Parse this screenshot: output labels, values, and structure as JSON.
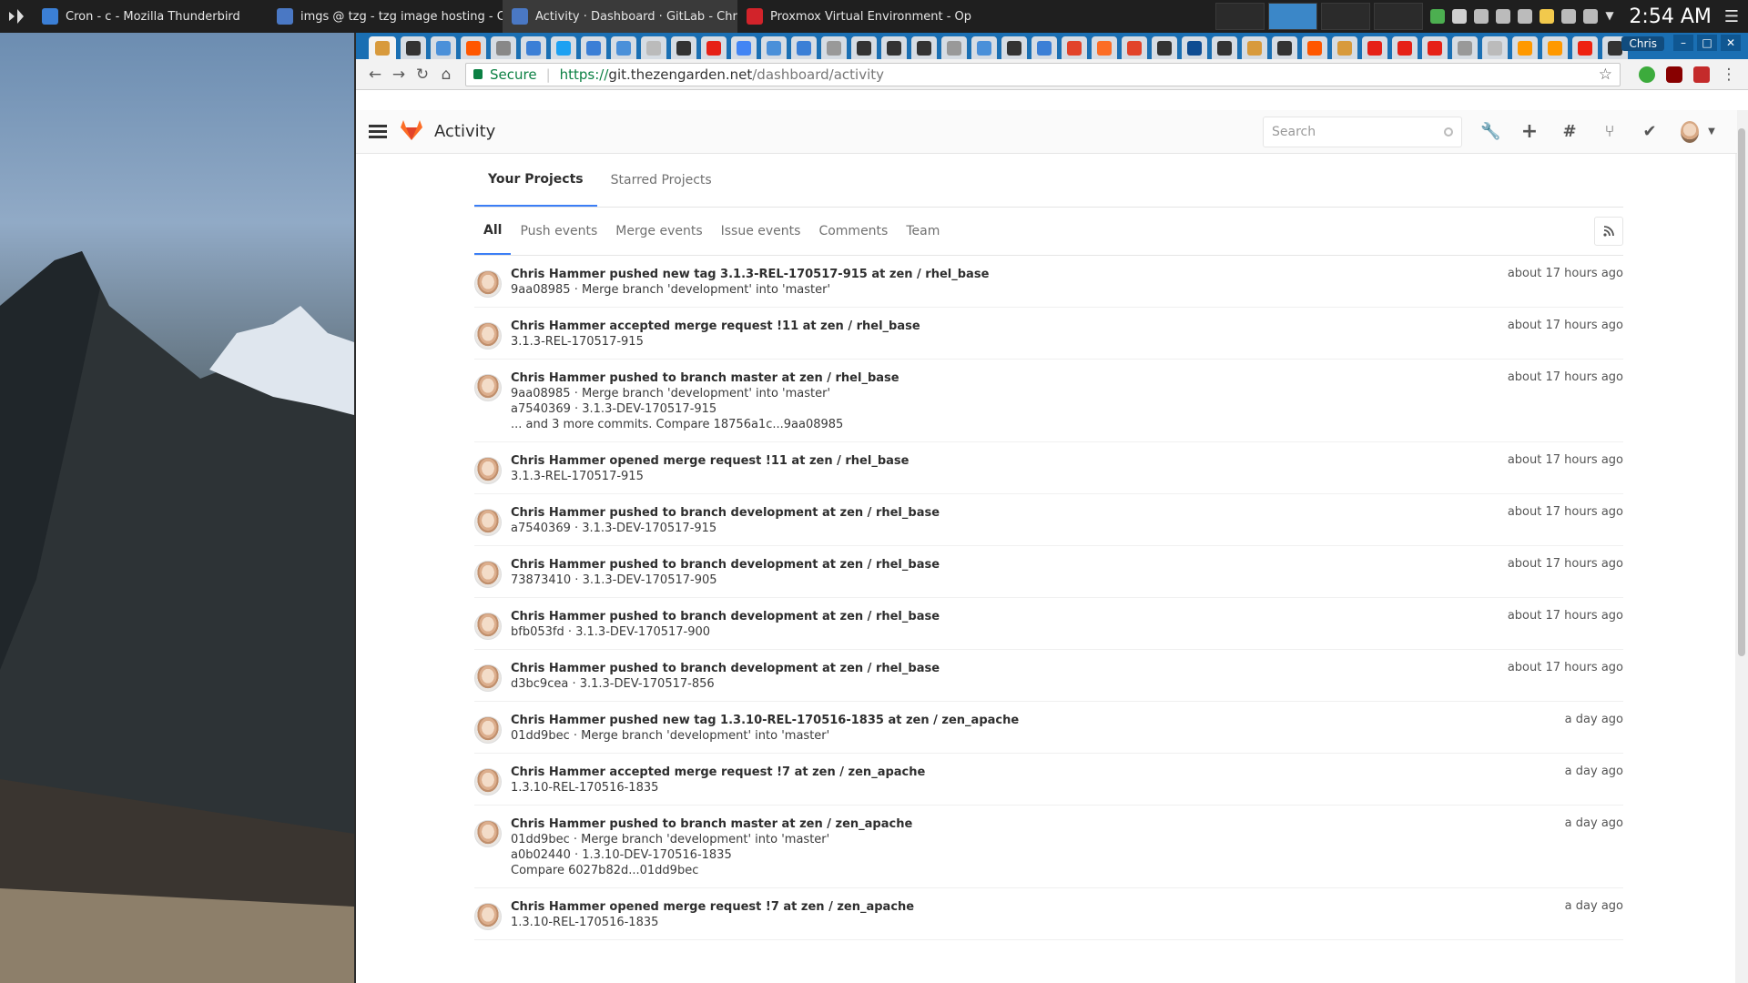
{
  "taskbar": {
    "tasks": [
      {
        "label": "Cron - c - Mozilla Thunderbird",
        "color": "#3b7fd6"
      },
      {
        "label": "imgs @ tzg - tzg image hosting - C...",
        "color": "#4a78c4"
      },
      {
        "label": "Activity · Dashboard · GitLab - Chr...",
        "color": "#4a78c4"
      },
      {
        "label": "Proxmox Virtual Environment - Op...",
        "color": "#d2232a"
      }
    ],
    "clock": "2:54 AM"
  },
  "browser": {
    "profile": "Chris",
    "url_scheme": "https://",
    "url_host": "git.thezengarden.net",
    "url_path": "/dashboard/activity",
    "secure_label": "Secure"
  },
  "gitlab": {
    "header_title": "Activity",
    "search_placeholder": "Search",
    "top_tabs": [
      "Your Projects",
      "Starred Projects"
    ],
    "filters": [
      "All",
      "Push events",
      "Merge events",
      "Issue events",
      "Comments",
      "Team"
    ]
  },
  "events": [
    {
      "title": "Chris Hammer pushed new tag 3.1.3-REL-170517-915 at zen / rhel_base",
      "lines": [
        "9aa08985 · Merge branch 'development' into 'master'"
      ],
      "time": "about 17 hours ago"
    },
    {
      "title": "Chris Hammer accepted merge request !11 at zen / rhel_base",
      "lines": [
        "3.1.3-REL-170517-915"
      ],
      "time": "about 17 hours ago"
    },
    {
      "title": "Chris Hammer pushed to branch master at zen / rhel_base",
      "lines": [
        "9aa08985 · Merge branch 'development' into 'master'",
        "a7540369 · 3.1.3-DEV-170517-915",
        "... and 3 more commits. Compare 18756a1c...9aa08985"
      ],
      "time": "about 17 hours ago"
    },
    {
      "title": "Chris Hammer opened merge request !11 at zen / rhel_base",
      "lines": [
        "3.1.3-REL-170517-915"
      ],
      "time": "about 17 hours ago"
    },
    {
      "title": "Chris Hammer pushed to branch development at zen / rhel_base",
      "lines": [
        "a7540369 · 3.1.3-DEV-170517-915"
      ],
      "time": "about 17 hours ago"
    },
    {
      "title": "Chris Hammer pushed to branch development at zen / rhel_base",
      "lines": [
        "73873410 · 3.1.3-DEV-170517-905"
      ],
      "time": "about 17 hours ago"
    },
    {
      "title": "Chris Hammer pushed to branch development at zen / rhel_base",
      "lines": [
        "bfb053fd · 3.1.3-DEV-170517-900"
      ],
      "time": "about 17 hours ago"
    },
    {
      "title": "Chris Hammer pushed to branch development at zen / rhel_base",
      "lines": [
        "d3bc9cea · 3.1.3-DEV-170517-856"
      ],
      "time": "about 17 hours ago"
    },
    {
      "title": "Chris Hammer pushed new tag 1.3.10-REL-170516-1835 at zen / zen_apache",
      "lines": [
        "01dd9bec · Merge branch 'development' into 'master'"
      ],
      "time": "a day ago"
    },
    {
      "title": "Chris Hammer accepted merge request !7 at zen / zen_apache",
      "lines": [
        "1.3.10-REL-170516-1835"
      ],
      "time": "a day ago"
    },
    {
      "title": "Chris Hammer pushed to branch master at zen / zen_apache",
      "lines": [
        "01dd9bec · Merge branch 'development' into 'master'",
        "a0b02440 · 1.3.10-DEV-170516-1835",
        "Compare 6027b82d...01dd9bec"
      ],
      "time": "a day ago"
    },
    {
      "title": "Chris Hammer opened merge request !7 at zen / zen_apache",
      "lines": [
        "1.3.10-REL-170516-1835"
      ],
      "time": "a day ago"
    }
  ]
}
